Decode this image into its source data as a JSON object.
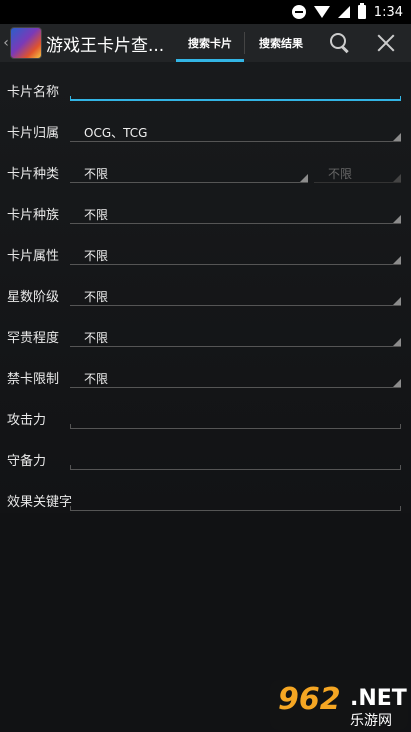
{
  "status_bar": {
    "time": "1:34"
  },
  "action_bar": {
    "title": "游戏王卡片查...",
    "tabs": [
      {
        "label": "搜索卡片",
        "active": true
      },
      {
        "label": "搜索结果",
        "active": false
      }
    ],
    "icons": [
      "search-icon",
      "close-icon"
    ]
  },
  "form": {
    "card_name": {
      "label": "卡片名称",
      "value": "",
      "placeholder": ""
    },
    "card_region": {
      "label": "卡片归属",
      "value": "OCG、TCG"
    },
    "card_type": {
      "label": "卡片种类",
      "value": "不限",
      "secondary_value": "不限"
    },
    "card_race": {
      "label": "卡片种族",
      "value": "不限"
    },
    "card_attribute": {
      "label": "卡片属性",
      "value": "不限"
    },
    "card_level": {
      "label": "星数阶级",
      "value": "不限"
    },
    "card_rarity": {
      "label": "罕贵程度",
      "value": "不限"
    },
    "card_limit": {
      "label": "禁卡限制",
      "value": "不限"
    },
    "attack": {
      "label": "攻击力",
      "value": ""
    },
    "defense": {
      "label": "守备力",
      "value": ""
    },
    "effect_keyword": {
      "label": "效果关键字",
      "value": ""
    }
  },
  "watermark": {
    "logo": "962",
    "suffix": ".NET",
    "subtitle": "乐游网"
  },
  "colors": {
    "accent": "#33b5e5",
    "background": "#111214",
    "action_bar": "#222426"
  }
}
